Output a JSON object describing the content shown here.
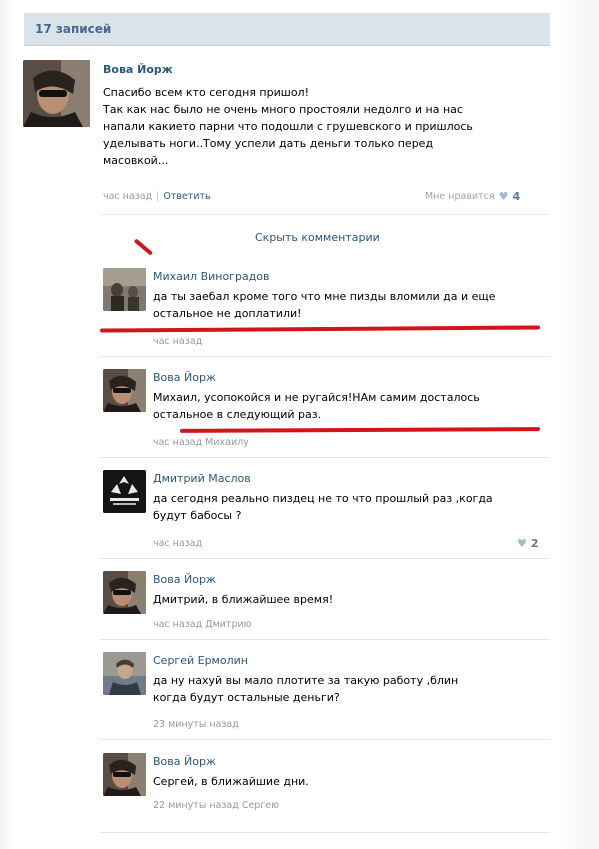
{
  "header": {
    "count_label": "17 записей"
  },
  "post": {
    "author": "Вова Йорж",
    "text_lines": [
      "Спасибо всем кто сегодня пришол!",
      "Так как нас было не очень много простояли недолго и на нас",
      "напали какието парни что подошли с грушевского и пришлось",
      "уделывать ноги..Тому успели дать деньги только перед",
      "масовкой..."
    ],
    "time": "час назад",
    "reply_label": "Ответить",
    "like_label": "Мне нравится",
    "like_count": "4"
  },
  "hide_comments_label": "Скрыть комментарии",
  "comments": [
    {
      "author": "Михаил Виноградов",
      "lines": [
        "да ты заебал кроме того что мне пизды вломили да и еще",
        "остальное не доплатили!"
      ],
      "meta": "час назад"
    },
    {
      "author": "Вова Йорж",
      "lines": [
        "Михаил, усопокойся и не ругайся!НАм самим досталось",
        "остальное в следующий раз."
      ],
      "meta": "час назад Михаилу"
    },
    {
      "author": "Дмитрий Маслов",
      "lines": [
        "да сегодня реально пиздец не то что прошлый раз ,когда",
        "будут бабосы ?"
      ],
      "meta": "час назад",
      "likes": "2"
    },
    {
      "author": "Вова Йорж",
      "lines": [
        "Дмитрий, в ближайшее время!"
      ],
      "meta": "час назад Дмитрию"
    },
    {
      "author": "Сергей Ермолин",
      "lines": [
        "да ну нахуй вы мало плотите за такую работу ,блин",
        "когда будут остальные деньги?"
      ],
      "meta": "23 минуты назад"
    },
    {
      "author": "Вова Йорж",
      "lines": [
        "Сергей, в ближайшие дни."
      ],
      "meta": "22 минуты назад Сергею"
    }
  ],
  "colors": {
    "link": "#2b587a",
    "header_bg": "#dae2ea",
    "header_text": "#45688e",
    "meta": "#999999",
    "highlight": "#d2141b"
  },
  "icons": {
    "like": "heart-icon"
  }
}
